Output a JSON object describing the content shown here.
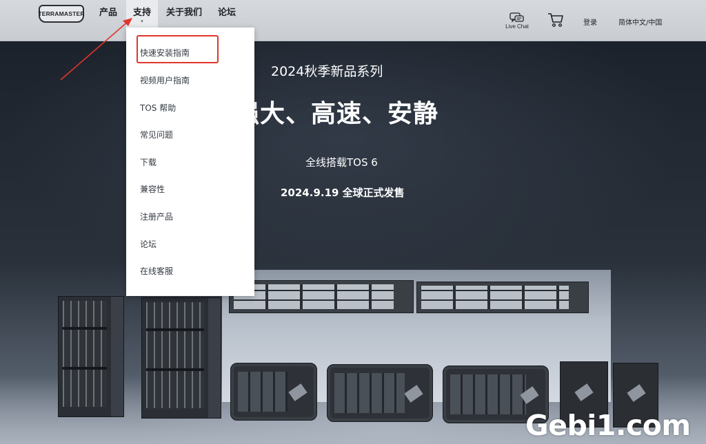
{
  "header": {
    "logo_text": "TERRAMASTER",
    "nav": [
      "产品",
      "支持",
      "关于我们",
      "论坛"
    ],
    "nav_caret": "▾",
    "livechat_label": "Live Chat",
    "login": "登录",
    "language": "简体中文/中国"
  },
  "dropdown": {
    "items": [
      "快速安装指南",
      "视频用户指南",
      "TOS 帮助",
      "常见问题",
      "下载",
      "兼容性",
      "注册产品",
      "论坛",
      "在线客服"
    ],
    "highlighted": "快速安装指南"
  },
  "hero": {
    "subtitle": "2024秋季新品系列",
    "headline": "强大、高速、安静",
    "tos": "全线搭载TOS 6",
    "date": "2024.9.19 全球正式发售"
  },
  "watermark": "Gebi1.com",
  "colors": {
    "accent_red": "#e0352b",
    "nav_bg": "#cfd2d6",
    "hero_bg": "#1c222b"
  },
  "icons": {
    "livechat": "chat-bubble-icon",
    "cart": "shopping-cart-icon"
  }
}
